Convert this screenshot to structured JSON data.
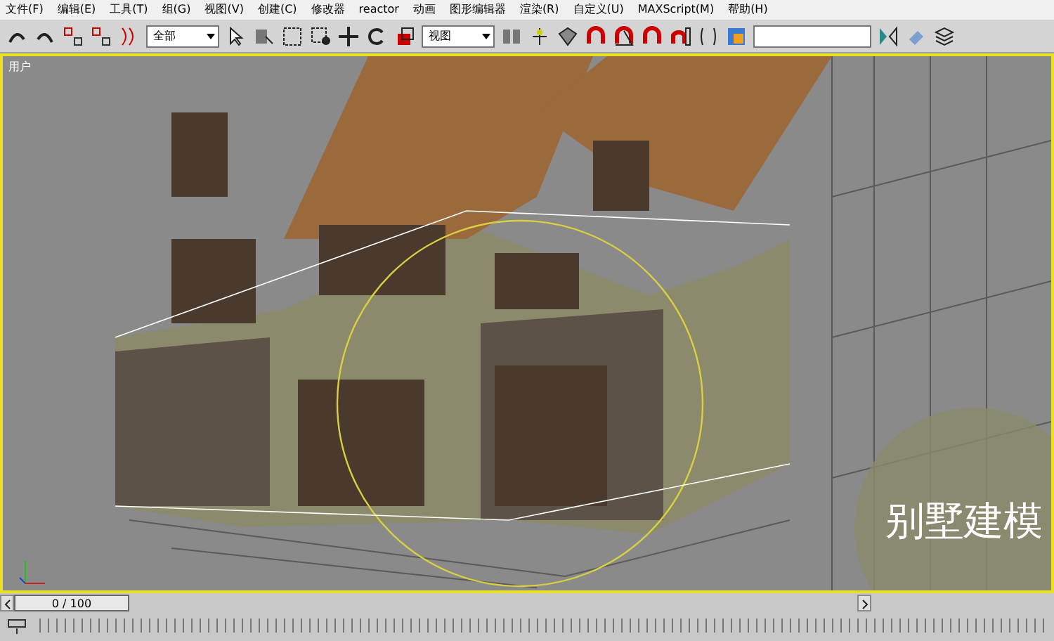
{
  "menu": [
    "文件(F)",
    "编辑(E)",
    "工具(T)",
    "组(G)",
    "视图(V)",
    "创建(C)",
    "修改器",
    "reactor",
    "动画",
    "图形编辑器",
    "渲染(R)",
    "自定义(U)",
    "MAXScript(M)",
    "帮助(H)"
  ],
  "toolbar": {
    "selection_filter": "全部",
    "reference_coordinate": "视图"
  },
  "viewport": {
    "label": "用户"
  },
  "caption": "别墅建模",
  "time_slider": {
    "frame": "0 / 100",
    "level": 0
  }
}
